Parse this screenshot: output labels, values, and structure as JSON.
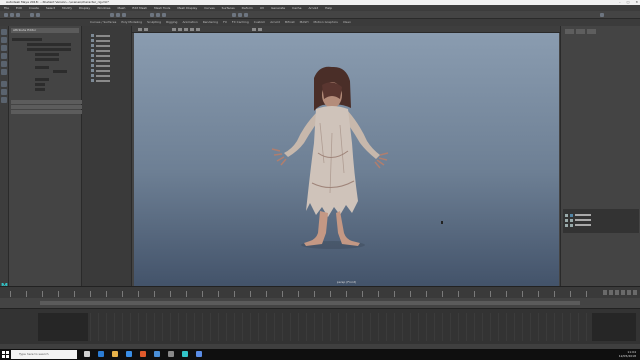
{
  "window": {
    "title": "Autodesk Maya 2018: …Student Version…\\scenes\\character_rig.mb*",
    "buttons": [
      "–",
      "□",
      "✕"
    ]
  },
  "menubar": [
    "File",
    "Edit",
    "Create",
    "Select",
    "Modify",
    "Display",
    "Windows",
    "Mesh",
    "Edit Mesh",
    "Mesh Tools",
    "Mesh Display",
    "Curves",
    "Surfaces",
    "Deform",
    "UV",
    "Generate",
    "Cache",
    "Arnold",
    "Help"
  ],
  "shelf_tabs": [
    "Curves / Surfaces",
    "Poly Modeling",
    "Sculpting",
    "Rigging",
    "Animation",
    "Rendering",
    "FX",
    "FX Caching",
    "Custom",
    "Arnold",
    "Bifrost",
    "MASH",
    "Motion Graphics",
    "XGen"
  ],
  "attribute_editor": {
    "header": "Attribute Editor",
    "sections": [
      "",
      "",
      ""
    ]
  },
  "viewport": {
    "camera_label": "persp (Front)"
  },
  "colors": {
    "accent": "#32c4c8",
    "selected_layer": "#5285a6"
  },
  "taskbar": {
    "search_placeholder": "Type here to search",
    "time": "11:04",
    "date": "12/05/2018"
  }
}
